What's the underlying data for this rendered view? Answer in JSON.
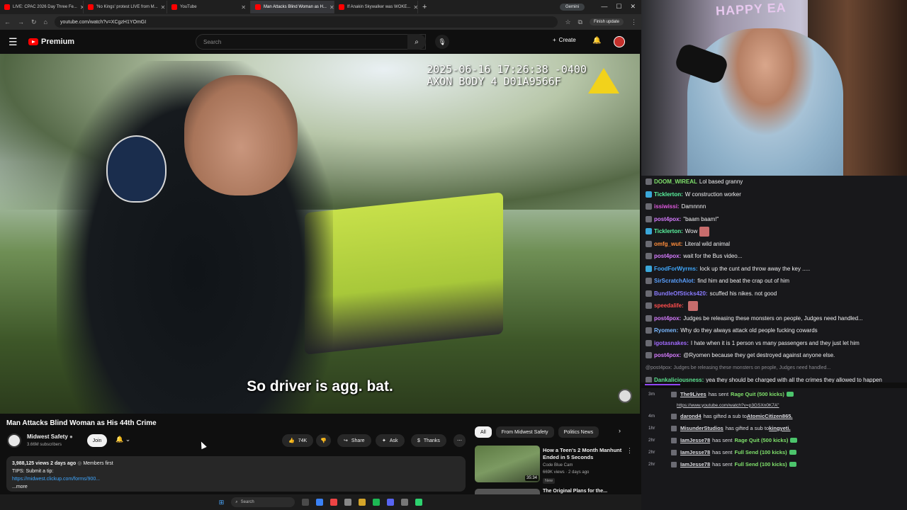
{
  "browser": {
    "tabs": [
      {
        "label": "LIVE: CPAC 2026 Day Three Fe...",
        "active": false
      },
      {
        "label": "'No Kings' protest LIVE from M...",
        "active": false
      },
      {
        "label": "YouTube",
        "active": false
      },
      {
        "label": "Man Attacks Blind Woman as H...",
        "active": true
      },
      {
        "label": "If Anakin Skywalker was WOKE...",
        "active": false
      }
    ],
    "gemini": "Gemini",
    "url": "youtube.com/watch?v=XCgzH1YOmGI",
    "finish_update": "Finish update"
  },
  "youtube": {
    "logo_text": "Premium",
    "search_placeholder": "Search",
    "create_label": "Create"
  },
  "video": {
    "osd_line1": "2025-06-16 17:26:38 -0400",
    "osd_line2": "AXON BODY 4 D01A9566F",
    "subtitle": "So driver is agg. bat."
  },
  "below": {
    "title": "Man Attacks Blind Woman as His 44th Crime",
    "channel": "Midwest Safety",
    "subscribers": "3.66M subscribers",
    "join": "Join",
    "likes": "74K",
    "share": "Share",
    "ask": "Ask",
    "thanks": "Thanks",
    "desc_meta": "3,988,125 views  2 days ago",
    "desc_members": "Members first",
    "desc_tips": "TIPS: Submit a tip:",
    "desc_link": "https://midwest.clickup.com/forms/900...",
    "desc_more": "...more"
  },
  "recommended": {
    "chips": [
      "All",
      "From Midwest Safety",
      "Politics News"
    ],
    "item1": {
      "title": "How a Teen's 2 Month Manhunt Ended in 5 Seconds",
      "channel": "Code Blue Cam",
      "views": "669K views · 2 days ago",
      "badge": "New",
      "duration": "35:34"
    },
    "item2_title": "The Original Plans for the..."
  },
  "taskbar": {
    "search": "Search"
  },
  "stream": {
    "easter_text": "HAPPY EA"
  },
  "chat": [
    {
      "user": "DOOM_WIREAL",
      "color": "#7fe06b",
      "text": "Lol based granny",
      "badge": ""
    },
    {
      "user": "Ticklerton:",
      "color": "#5af5a0",
      "text": "W construction worker",
      "badge": "blue"
    },
    {
      "user": "issiwissi:",
      "color": "#e05adf",
      "text": "Damnnnn",
      "badge": ""
    },
    {
      "user": "post4pox:",
      "color": "#d67bff",
      "text": "\"baam baam!\"",
      "badge": ""
    },
    {
      "user": "Ticklerton:",
      "color": "#5af5a0",
      "text": "Wow",
      "badge": "blue",
      "emote": true
    },
    {
      "user": "omfg_wut:",
      "color": "#ff8c3a",
      "text": "Literal wild animal",
      "badge": ""
    },
    {
      "user": "post4pox:",
      "color": "#d67bff",
      "text": "wait for the Bus video...",
      "badge": ""
    },
    {
      "user": "FoodForWyrms:",
      "color": "#3fa9ff",
      "text": "lock up the cunt and throw away the key .....",
      "badge": "blue"
    },
    {
      "user": "SirScratchAlot:",
      "color": "#5aa0ff",
      "text": "find him and beat the crap out of him",
      "badge": ""
    },
    {
      "user": "BundleOfSticks420:",
      "color": "#8a7bff",
      "text": "scuffed his nikes. not good",
      "badge": ""
    },
    {
      "user": "speedalife:",
      "color": "#ff4d4d",
      "text": "",
      "badge": "",
      "emote": true
    },
    {
      "user": "post4pox:",
      "color": "#d67bff",
      "text": "Judges be releasing these monsters on people, Judges need handled...",
      "badge": ""
    },
    {
      "user": "Ryomen:",
      "color": "#7ab8ff",
      "text": "Why do they always attack old people fucking cowards",
      "badge": ""
    },
    {
      "user": "igotasnakes:",
      "color": "#a36bff",
      "text": "I hate when it is 1 person vs many passengers and they just let him",
      "badge": ""
    },
    {
      "user": "post4pox:",
      "color": "#d67bff",
      "text": "@Ryomen because they get destroyed against anyone else.",
      "badge": ""
    },
    {
      "user": "",
      "color": "#8b8b91",
      "text": "@post4pox: Judges be releasing these monsters on people, Judges need handled...",
      "badge": "",
      "reply": true
    },
    {
      "user": "Dankaliciousness:",
      "color": "#5ae08c",
      "text": "yea they should be charged with all the crimes they allowed to happen",
      "badge": ""
    }
  ],
  "events": [
    {
      "time": "3m",
      "user": "The9Lives",
      "mid": "has sent",
      "hl": "Rage Quit (500 kicks)",
      "gif": true,
      "link": "https://www.youtube.com/watch?v=p3GSXn0K7A\""
    },
    {
      "time": "4m",
      "user": "darond4",
      "mid": "has gifted a sub to",
      "hl": "",
      "tail": "AtomicCitizen865."
    },
    {
      "time": "1hr",
      "user": "MisunderStudios",
      "mid": "has gifted a sub to",
      "hl": "",
      "tail": "kingyeti."
    },
    {
      "time": "2hr",
      "user": "IamJesse78",
      "mid": "has sent",
      "hl": "Rage Quit (500 kicks)",
      "gif": true
    },
    {
      "time": "2hr",
      "user": "IamJesse78",
      "mid": "has sent",
      "hl": "Full Send (100 kicks)",
      "gif": true
    },
    {
      "time": "2hr",
      "user": "IamJesse78",
      "mid": "has sent",
      "hl": "Full Send (100 kicks)",
      "gif": true
    }
  ]
}
